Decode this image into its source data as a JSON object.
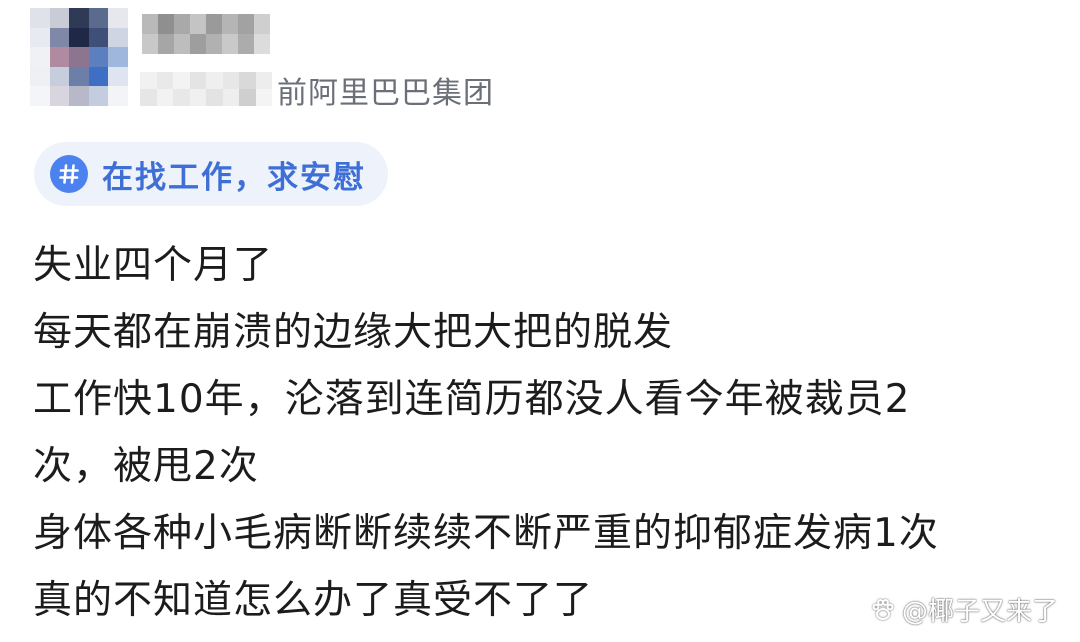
{
  "post": {
    "company": "前阿里巴巴集团",
    "topic_tag": "在找工作，求安慰",
    "body_lines": [
      "失业四个月了",
      "每天都在崩溃的边缘大把大把的脱发",
      "工作快10年，沦落到连简历都没人看今年被裁员2",
      "次，被甩2次",
      "身体各种小毛病断断续续不断严重的抑郁症发病1次",
      "真的不知道怎么办了真受不了了"
    ]
  },
  "watermark": {
    "text": "@椰子又来了",
    "icon": "paw-icon"
  },
  "colors": {
    "tag_background": "#edf2fb",
    "tag_text": "#3f6fd6",
    "tag_icon": "#4b82f0",
    "meta_text": "#6b6f78",
    "body_text": "#1c1c1c"
  },
  "icons": {
    "topic": "hashtag-icon",
    "avatar": "blurred-avatar"
  }
}
